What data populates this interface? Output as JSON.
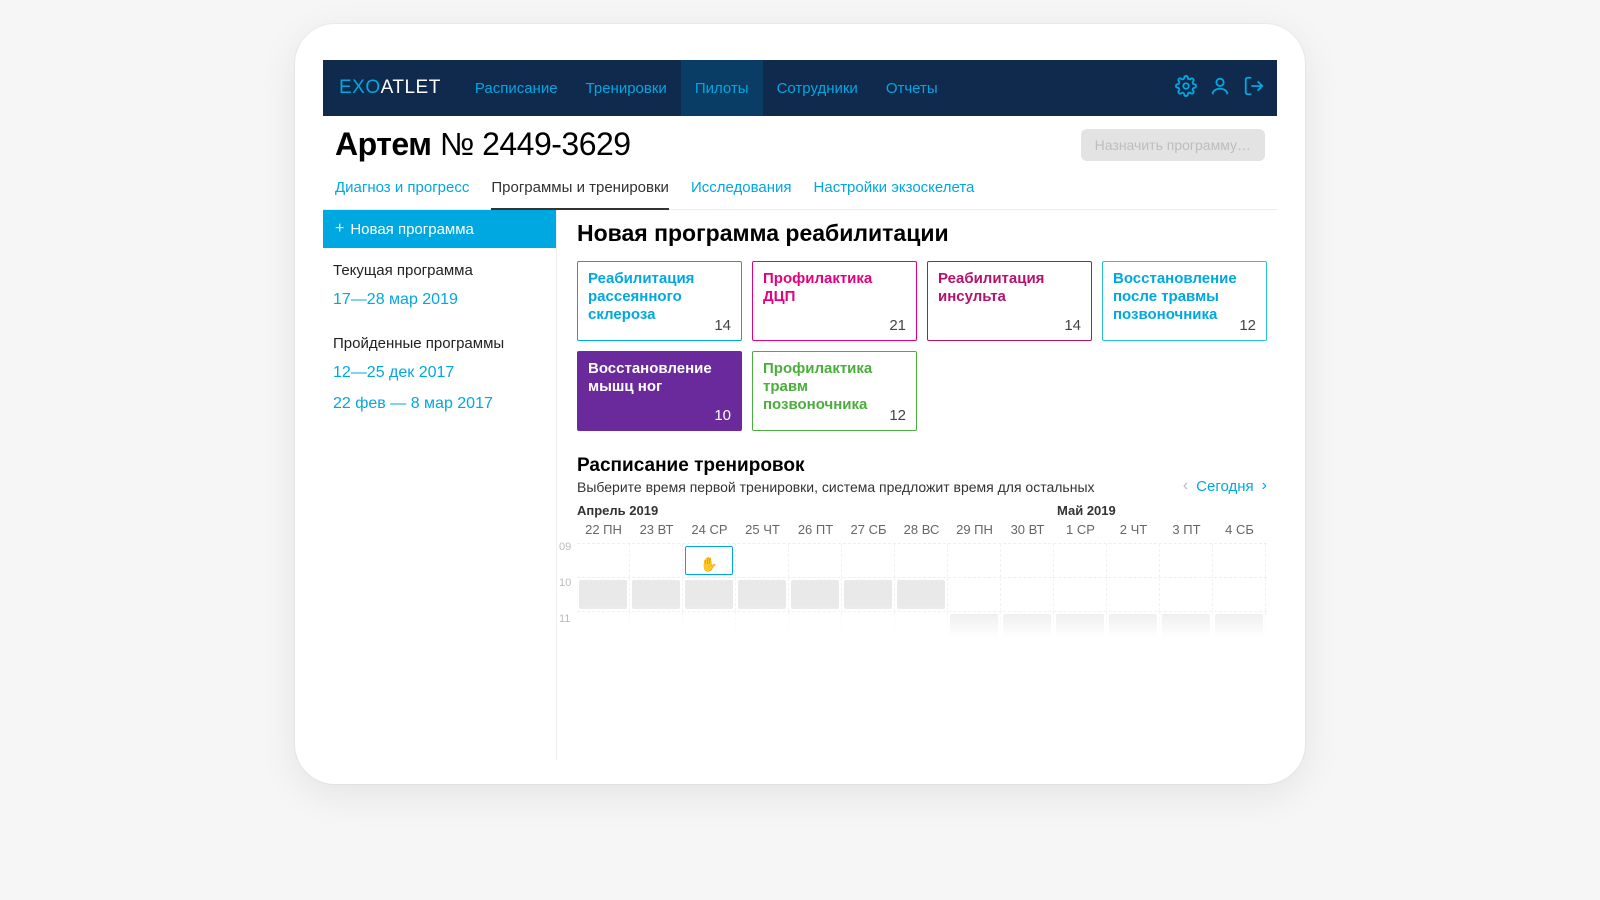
{
  "brand": {
    "exo": "EXO",
    "atlet": "ATLET"
  },
  "nav": {
    "items": [
      "Расписание",
      "Тренировки",
      "Пилоты",
      "Сотрудники",
      "Отчеты"
    ],
    "active_index": 2
  },
  "page": {
    "name": "Артем",
    "number_label": "№ 2449-3629",
    "assign_btn": "Назначить программу…"
  },
  "tabs": {
    "items": [
      "Диагноз и прогресс",
      "Программы и тренировки",
      "Исследования",
      "Настройки экзоскелета"
    ],
    "active_index": 1
  },
  "sidebar": {
    "new_btn": "Новая программа",
    "current_label": "Текущая программа",
    "current_link": "17—28 мар 2019",
    "past_label": "Пройденные программы",
    "past_links": [
      "12—25 дек 2017",
      "22 фев — 8 мар 2017"
    ]
  },
  "main": {
    "title": "Новая программа реабилитации",
    "cards": [
      {
        "title": "Реабилитация рассеянного склероза",
        "count": "14",
        "theme": "c-blue"
      },
      {
        "title": "Профилактика ДЦП",
        "count": "21",
        "theme": "c-pink"
      },
      {
        "title": "Реабилитация инсульта",
        "count": "14",
        "theme": "c-dpink"
      },
      {
        "title": "Восстановление после травмы позвоночника",
        "count": "12",
        "theme": "c-cyan"
      },
      {
        "title": "Восстановление мышц ног",
        "count": "10",
        "theme": "c-purple",
        "filled": true
      },
      {
        "title": "Профилактика травм позвоночника",
        "count": "12",
        "theme": "c-green"
      }
    ],
    "schedule": {
      "title": "Расписание тренировок",
      "subtitle": "Выберите время первой тренировки, система предложит время для остальных",
      "today": "Сегодня",
      "month1": "Апрель 2019",
      "month2": "Май 2019",
      "days": [
        "22 ПН",
        "23 ВТ",
        "24 СР",
        "25 ЧТ",
        "26 ПТ",
        "27 СБ",
        "28 ВС",
        "29 ПН",
        "30 ВТ",
        "1 СР",
        "2 ЧТ",
        "3 ПТ",
        "4 СБ"
      ],
      "hours": [
        "09",
        "10",
        "11"
      ],
      "blocks_row0": [
        false,
        false,
        "sel",
        false,
        false,
        false,
        false,
        false,
        false,
        false,
        false,
        false,
        false
      ],
      "blocks_row1": [
        true,
        true,
        true,
        true,
        true,
        true,
        true,
        false,
        false,
        false,
        false,
        false,
        false
      ],
      "blocks_row2": [
        false,
        false,
        false,
        false,
        false,
        false,
        false,
        true,
        true,
        true,
        true,
        true,
        true
      ]
    }
  }
}
